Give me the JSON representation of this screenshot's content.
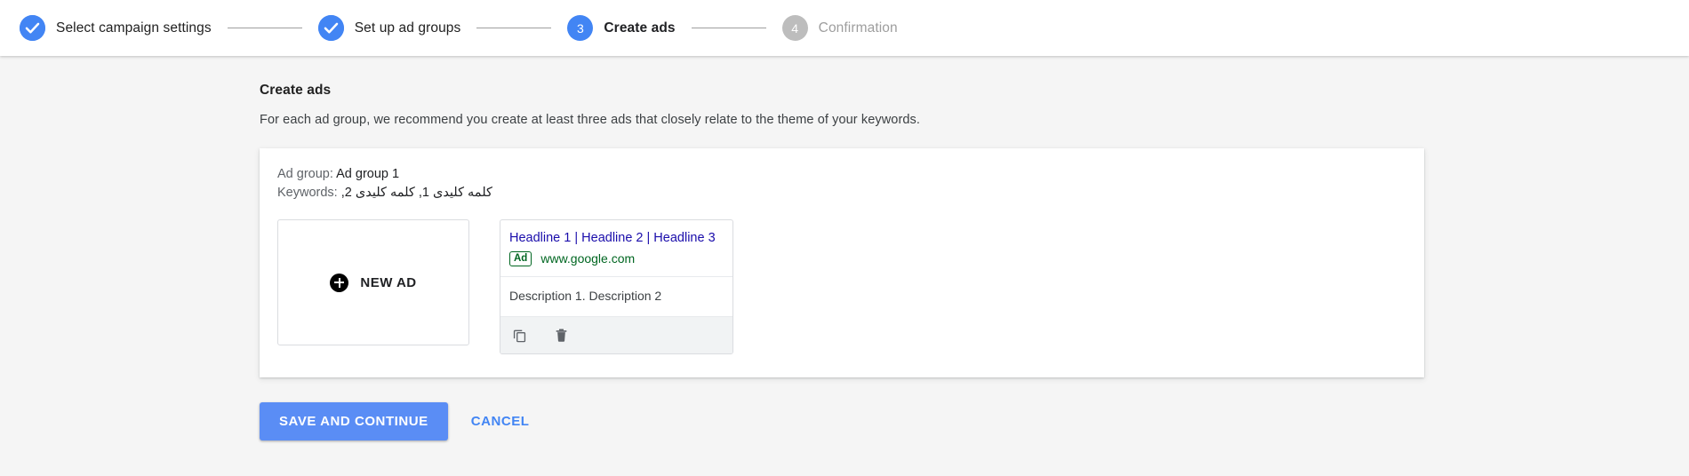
{
  "stepper": {
    "steps": [
      {
        "marker": "check",
        "label": "Select campaign settings",
        "state": "done"
      },
      {
        "marker": "check",
        "label": "Set up ad groups",
        "state": "done"
      },
      {
        "marker": "3",
        "label": "Create ads",
        "state": "active"
      },
      {
        "marker": "4",
        "label": "Confirmation",
        "state": "todo"
      }
    ],
    "colors": {
      "active": "#4285f4",
      "todo": "#bdbdbd"
    }
  },
  "main": {
    "title": "Create ads",
    "subtitle": "For each ad group, we recommend you create at least three ads that closely relate to the theme of your keywords."
  },
  "ad_group": {
    "ad_group_label": "Ad group:",
    "ad_group_value": "Ad group 1",
    "keywords_label": "Keywords:",
    "keywords_value": "کلمه کلیدی 1, کلمه کلیدی 2,"
  },
  "new_ad_tile": {
    "label": "NEW AD",
    "icon": "plus-circle-icon"
  },
  "ad_preview": {
    "headlines": "Headline 1 | Headline 2 | Headline 3",
    "ad_badge": "Ad",
    "display_url": "www.google.com",
    "description": "Description 1. Description 2",
    "actions": [
      {
        "name": "copy-icon",
        "title": "Copy"
      },
      {
        "name": "delete-icon",
        "title": "Delete"
      }
    ]
  },
  "footer": {
    "save_label": "SAVE AND CONTINUE",
    "cancel_label": "CANCEL",
    "primary_color": "#5a8df5",
    "link_color": "#4285f4"
  }
}
